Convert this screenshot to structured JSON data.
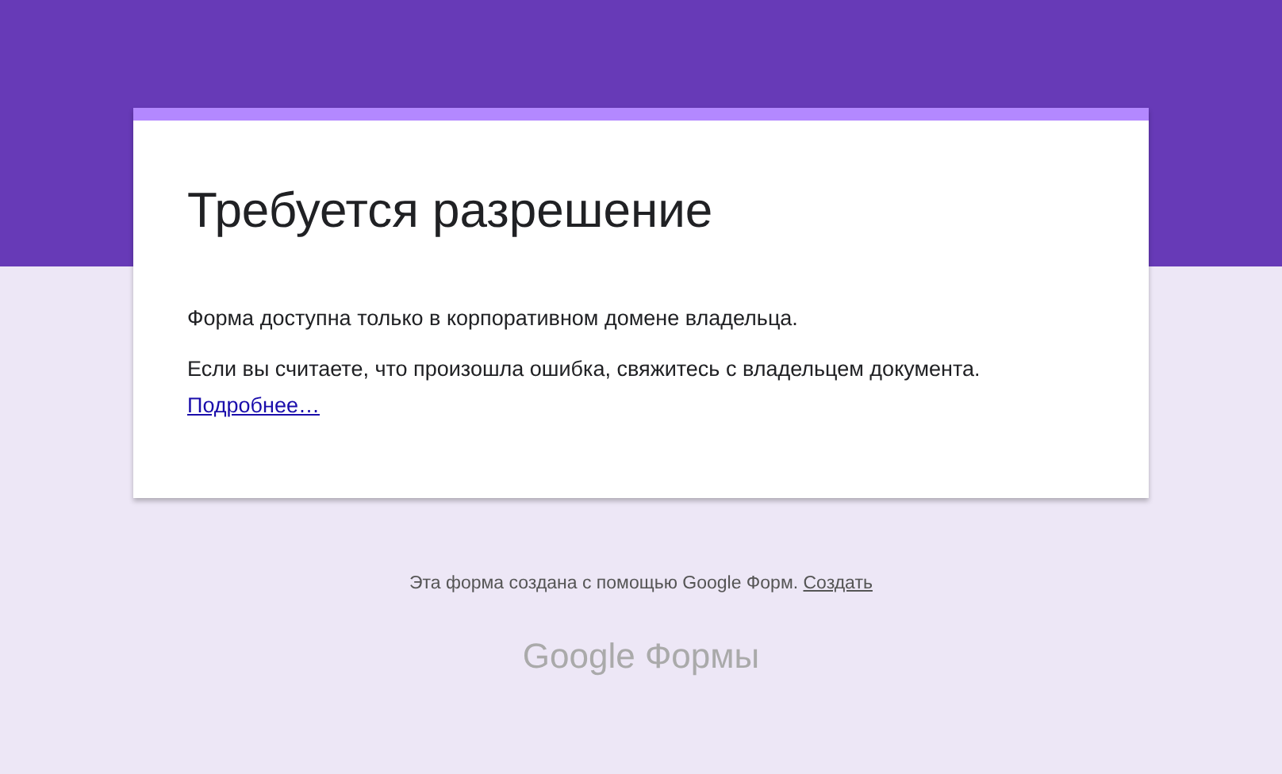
{
  "card": {
    "title": "Требуется разрешение",
    "paragraphs": [
      "Форма доступна только в корпоративном домене владельца.",
      "Если вы считаете, что произошла ошибка, свяжитесь с владельцем документа."
    ],
    "link": "Подробнее…"
  },
  "footer": {
    "text": "Эта форма создана с помощью Google Форм.",
    "link": "Создать",
    "logo": "Google Формы"
  }
}
